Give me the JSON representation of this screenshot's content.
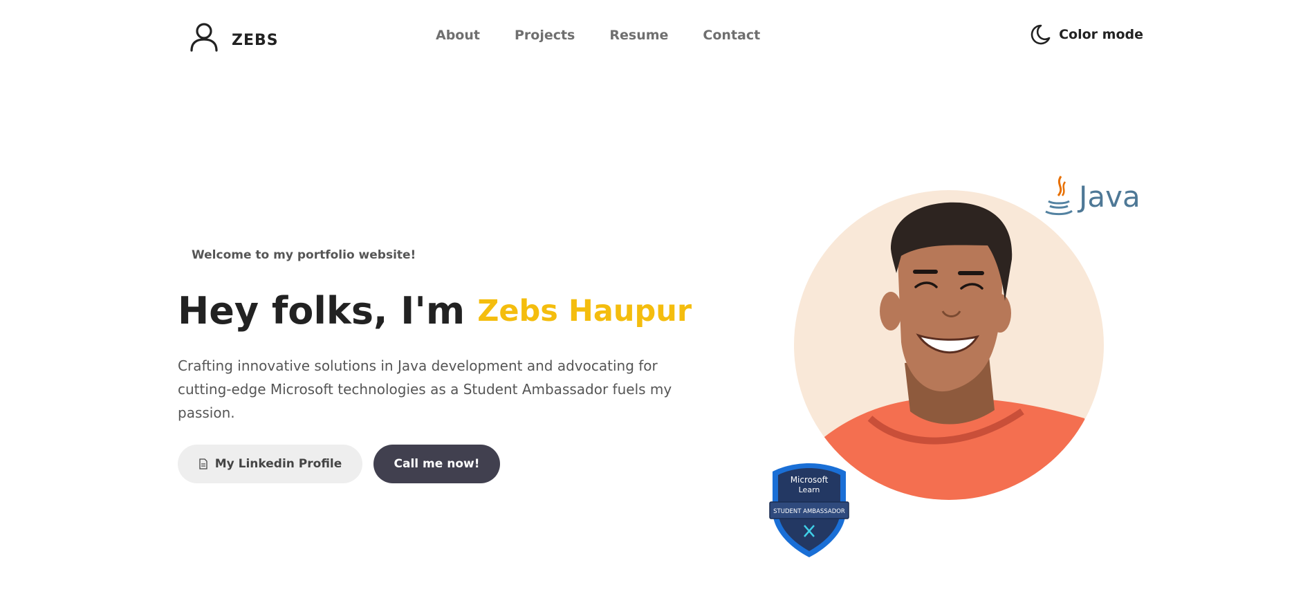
{
  "header": {
    "brand": "ZEBS",
    "nav": [
      "About",
      "Projects",
      "Resume",
      "Contact"
    ],
    "color_mode_label": "Color mode"
  },
  "hero": {
    "welcome": "Welcome to my portfolio website!",
    "greeting": "Hey folks, I'm",
    "name": "Zebs Haupur",
    "subtitle": "Crafting innovative solutions in Java development and advocating for cutting-edge Microsoft technologies as a Student Ambassador fuels my passion.",
    "linkedin_button": "My Linkedin Profile",
    "call_button": "Call me now!"
  },
  "illustration": {
    "java_label": "Java",
    "badge_line1": "Microsoft",
    "badge_line2": "Learn",
    "badge_ribbon": "STUDENT AMBASSADOR"
  },
  "colors": {
    "accent": "#f4bd0e",
    "dark_button": "#41404f",
    "light_button": "#eeeeee",
    "avatar_bg": "#f9e8d8",
    "shirt": "#f46f50"
  }
}
